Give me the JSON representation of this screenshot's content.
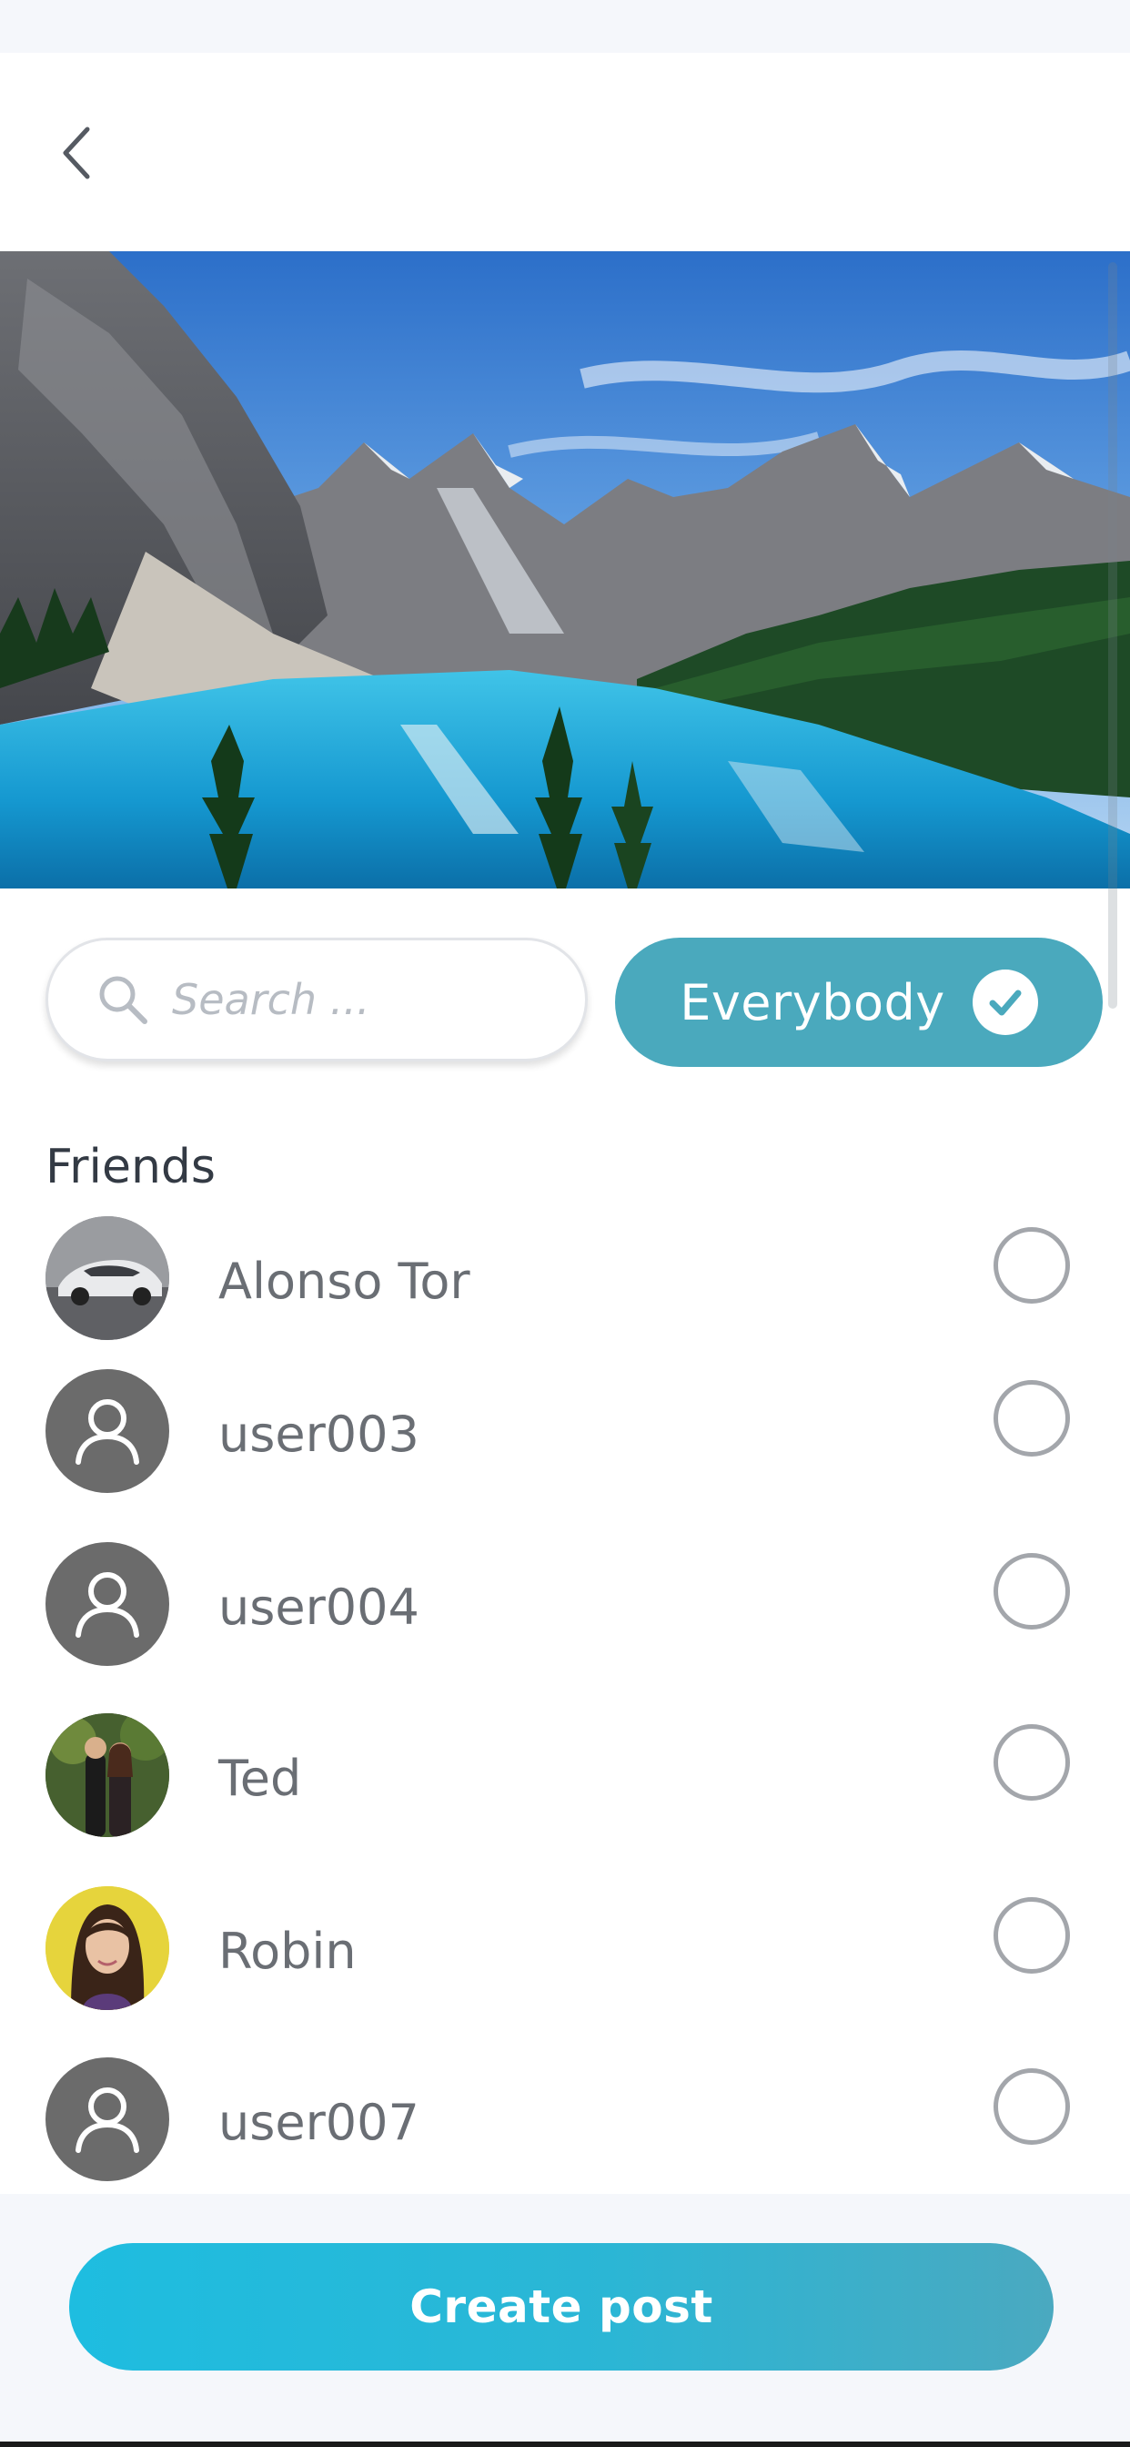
{
  "header": {
    "back_icon": "chevron-left-icon"
  },
  "search": {
    "placeholder": "Search ...",
    "value": "",
    "icon": "search-icon"
  },
  "audience_button": {
    "label": "Everybody",
    "selected": true,
    "icon": "check-circle-icon"
  },
  "friends": {
    "title": "Friends",
    "items": [
      {
        "name": "Alonso Tor",
        "avatar": "car-photo",
        "selected": false
      },
      {
        "name": "user003",
        "avatar": "default-user-icon",
        "selected": false
      },
      {
        "name": "user004",
        "avatar": "default-user-icon",
        "selected": false
      },
      {
        "name": "Ted",
        "avatar": "couple-photo",
        "selected": false
      },
      {
        "name": "Robin",
        "avatar": "woman-portrait-photo",
        "selected": false
      },
      {
        "name": "user007",
        "avatar": "default-user-icon",
        "selected": false
      }
    ]
  },
  "footer": {
    "create_label": "Create post"
  },
  "colors": {
    "accent": "#4aa9bd",
    "button_gradient_start": "#1ebde0",
    "button_gradient_end": "#4aa9c0",
    "text": "#6a6e74",
    "radio_border": "#a3a6ab"
  }
}
